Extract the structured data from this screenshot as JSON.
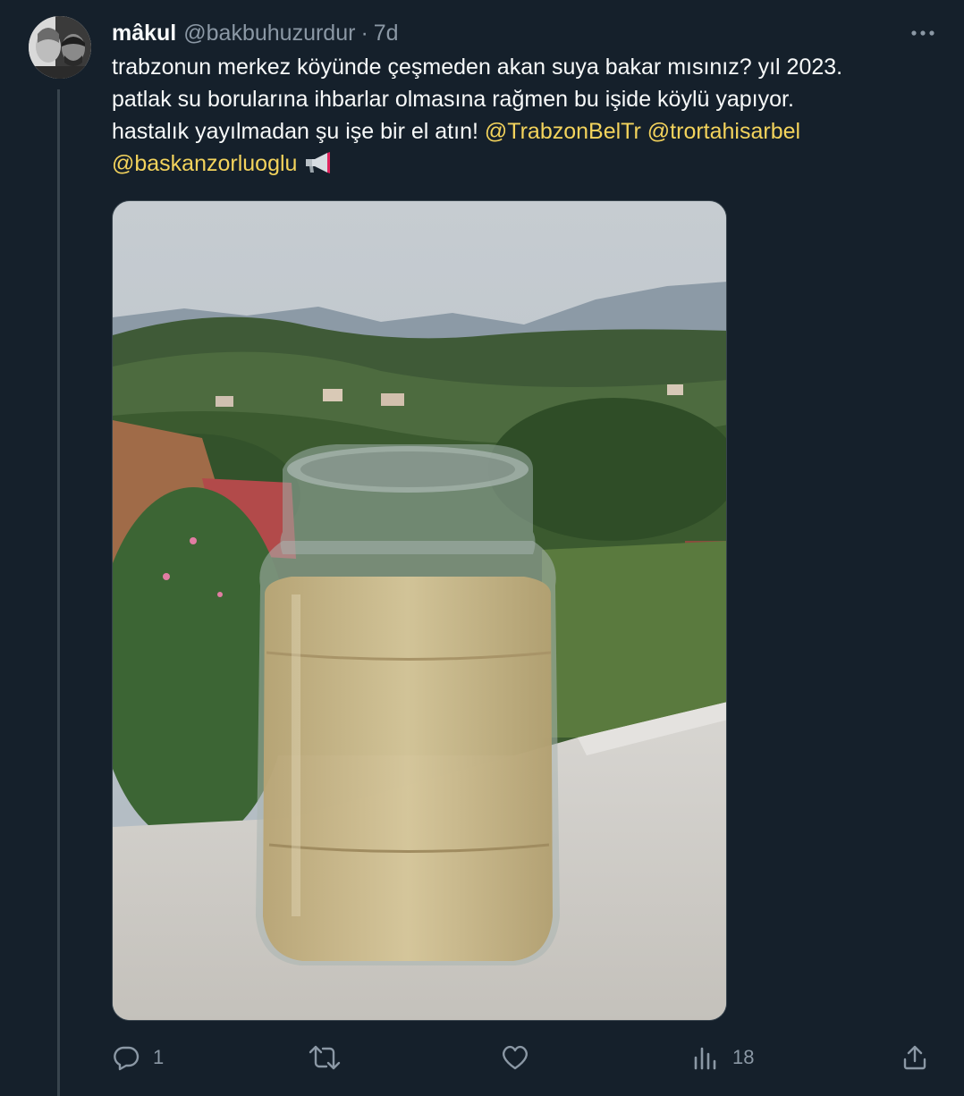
{
  "tweet": {
    "display_name": "mâkul",
    "handle": "@bakbuhuzurdur",
    "separator": "·",
    "time": "7d",
    "text_lines": [
      "trabzonun merkez köyünde çeşmeden akan suya bakar mısınız? yıl 2023.",
      "patlak su borularına ihbarlar olmasına rağmen bu işide köylü yapıyor.",
      "hastalık yayılmadan şu işe bir el atın! "
    ],
    "mentions": [
      "@TrabzonBelTr",
      "@trortahisarbel",
      "@baskanzorluoglu"
    ],
    "emoji": "megaphone-icon"
  },
  "actions": {
    "reply_count": "1",
    "retweet_count": "",
    "like_count": "",
    "views_count": "18"
  },
  "colors": {
    "background": "#15202b",
    "text": "#f7f9f9",
    "secondary": "#8b98a5",
    "mention": "#f3d35c",
    "divider": "#38444d"
  }
}
